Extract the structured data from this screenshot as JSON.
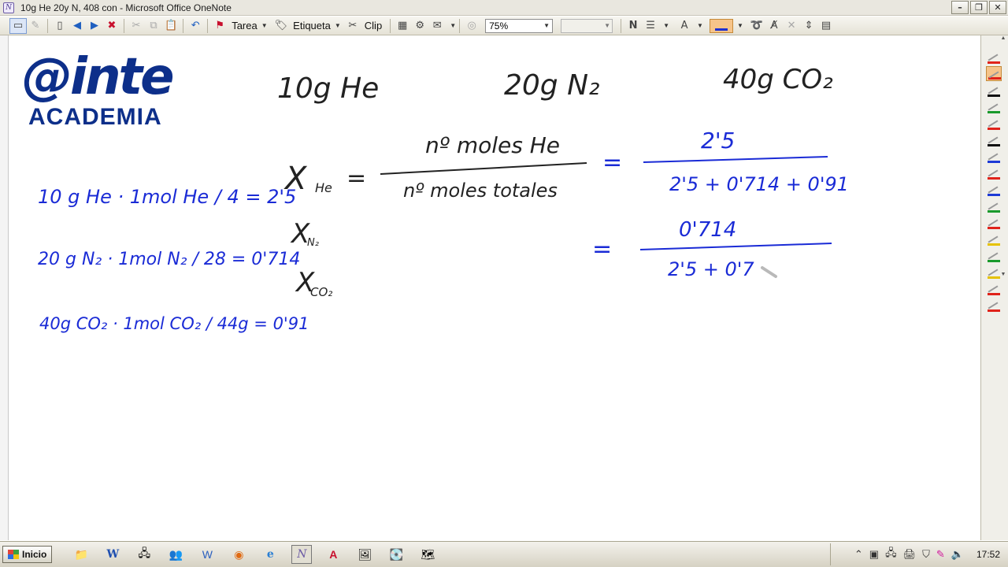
{
  "window": {
    "title": "10g He 20y N, 408 con - Microsoft Office OneNote",
    "buttons": [
      "minimize",
      "maximize",
      "close"
    ]
  },
  "toolbar": {
    "tarea_label": "Tarea",
    "etiqueta_label": "Etiqueta",
    "clip_label": "Clip",
    "zoom_value": "75%",
    "font_value": "",
    "accent_pen_color": "#f6c48a",
    "active_ink_color": "#1d2fd0"
  },
  "logo": {
    "word": "@inte",
    "sub": "ACADEMIA"
  },
  "notes": {
    "header": [
      "10g He",
      "20g N₂",
      "40g CO₂"
    ],
    "left": {
      "line1": "10 g He · 1mol He / 4 = 2'5",
      "line2": "20 g N₂ · 1mol N₂ / 28 = 0'714",
      "line3": "40g CO₂ · 1mol CO₂ / 44g = 0'91"
    },
    "x_he": "X",
    "x_he_sub": "He",
    "frac_num": "nº moles He",
    "frac_den": "nº moles totales",
    "eq": "=",
    "r1_num": "2'5",
    "r1_den": "2'5 + 0'714 + 0'91",
    "x_n2_sub": "N₂",
    "x_co2_sub": "CO₂",
    "r2_num": "0'714",
    "r2_den": "2'5 + 0'7"
  },
  "taskbar": {
    "start_label": "Inicio",
    "clock": "17:52"
  },
  "colors": {
    "ink_black": "#222222",
    "ink_blue": "#1a2bd6",
    "logo_blue": "#0d2f8a"
  }
}
